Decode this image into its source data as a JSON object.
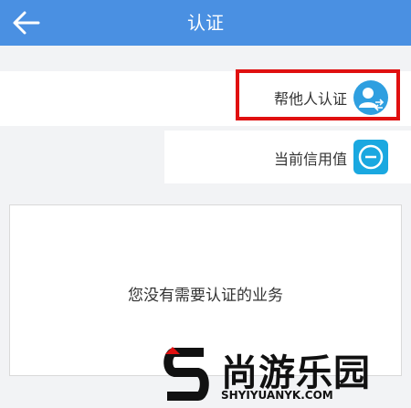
{
  "header": {
    "title": "认证"
  },
  "rows": {
    "help_others_label": "帮他人认证",
    "credit_label": "当前信用值"
  },
  "card": {
    "empty_text": "您没有需要认证的业务"
  },
  "watermark": {
    "cn": "尚游乐园",
    "en": "SHYIYUANYK.COM"
  },
  "colors": {
    "header": "#4a90e2",
    "highlight": "#e01010",
    "icon": "#2f9fe0"
  }
}
